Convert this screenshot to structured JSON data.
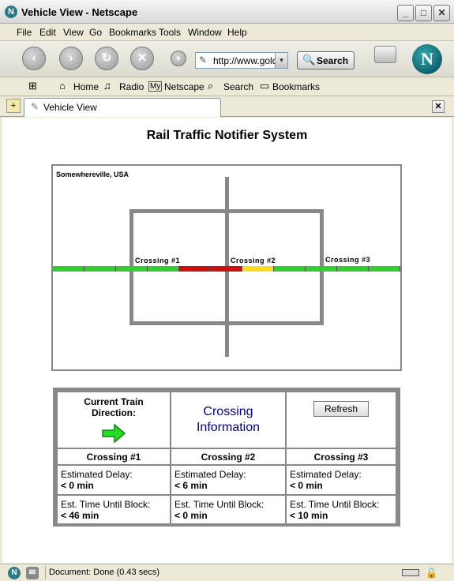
{
  "window": {
    "title": "Vehicle View - Netscape"
  },
  "menu": [
    "File",
    "Edit",
    "View",
    "Go",
    "Bookmarks",
    "Tools",
    "Window",
    "Help"
  ],
  "nav": {
    "url": "http://www.gold",
    "search_label": "Search"
  },
  "personal_toolbar": {
    "home": "Home",
    "radio": "Radio",
    "netscape": "Netscape",
    "search": "Search",
    "bookmarks": "Bookmarks"
  },
  "tab": {
    "label": "Vehicle View"
  },
  "page": {
    "title": "Rail Traffic Notifier System",
    "map": {
      "location": "Somewhereville, USA",
      "crossings": [
        "Crossing #1",
        "Crossing #2",
        "Crossing #3"
      ],
      "track_segments": [
        "green",
        "green",
        "green",
        "green",
        "red",
        "red",
        "yellow",
        "green",
        "green",
        "green",
        "green"
      ],
      "colors": {
        "green": "#33cc33",
        "red": "#cc1111",
        "yellow": "#ffdd22",
        "road": "#888888"
      }
    },
    "info": {
      "direction_label": "Current Train Direction:",
      "direction": "right",
      "heading": "Crossing Information",
      "refresh_label": "Refresh",
      "delay_label": "Estimated Delay:",
      "block_label": "Est. Time Until Block:",
      "crossings": [
        {
          "name": "Crossing #1",
          "delay": "< 0 min",
          "block": "< 46 min"
        },
        {
          "name": "Crossing #2",
          "delay": "< 6 min",
          "block": "< 0 min"
        },
        {
          "name": "Crossing #3",
          "delay": "< 0 min",
          "block": "< 10 min"
        }
      ]
    }
  },
  "status": {
    "text": "Document: Done (0.43 secs)"
  }
}
